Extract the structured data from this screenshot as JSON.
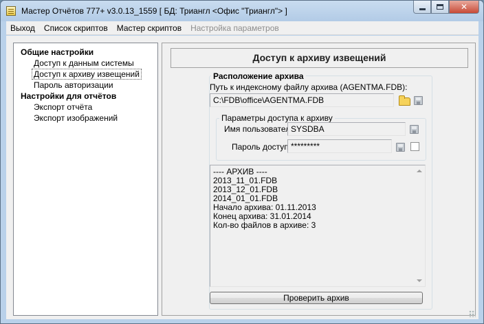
{
  "window": {
    "title": "Мастер Отчётов 777+ v3.0.13_1559 [ БД: Триангл <Офис \"Триангл\"> ]"
  },
  "menu": [
    {
      "label": "Выход",
      "enabled": true
    },
    {
      "label": "Список скриптов",
      "enabled": true
    },
    {
      "label": "Мастер скриптов",
      "enabled": true
    },
    {
      "label": "Настройка параметров",
      "enabled": false
    }
  ],
  "tree": {
    "general": {
      "label": "Общие настройки",
      "items": [
        {
          "label": "Доступ к данным системы"
        },
        {
          "label": "Доступ к архиву извещений"
        },
        {
          "label": "Пароль авторизации"
        }
      ]
    },
    "reports": {
      "label": "Настройки для отчётов",
      "items": [
        {
          "label": "Экспорт отчёта"
        },
        {
          "label": "Экспорт изображений"
        }
      ]
    }
  },
  "panel": {
    "header": "Доступ к архиву извещений",
    "archive_group": {
      "title": "Расположение архива",
      "path_label": "Путь к индексному файлу архива (AGENTMA.FDB):",
      "path_value": "C:\\FDB\\office\\AGENTMA.FDB"
    },
    "access_group": {
      "title": "Параметры доступа к архиву",
      "user_label": "Имя пользователя",
      "user_value": "SYSDBA",
      "password_label": "Пароль доступа",
      "password_value": "*********",
      "show_password_checked": false
    },
    "log_lines": [
      "---- АРХИВ ----",
      "2013_11_01.FDB",
      "2013_12_01.FDB",
      "2014_01_01.FDB",
      "Начало архива: 01.11.2013",
      "Конец  архива: 31.01.2014",
      "Кол-во файлов в архиве: 3"
    ],
    "check_button": "Проверить архив"
  },
  "colors": {
    "window_frame": "#b9d1ea",
    "client_bg": "#f0f0f0",
    "disabled_text": "#8d8d8d"
  }
}
